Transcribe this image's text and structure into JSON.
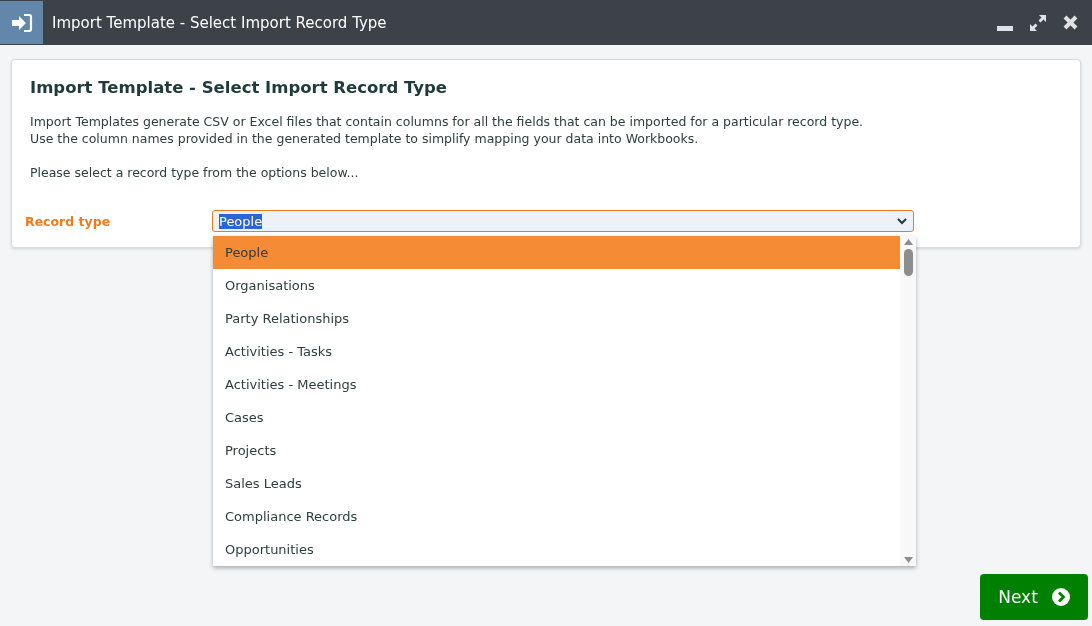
{
  "window": {
    "title": "Import Template - Select Import Record Type"
  },
  "card": {
    "heading": "Import Template - Select Import Record Type",
    "description": [
      "Import Templates generate CSV or Excel files that contain columns for all the fields that can be imported for a particular record type.",
      "Use the column names provided in the generated template to simplify mapping your data into Workbooks."
    ],
    "instruction": "Please select a record type from the options below...",
    "field_label": "Record type",
    "field_value": "People",
    "dropdown_open": true
  },
  "options": [
    {
      "label": "People",
      "selected": true
    },
    {
      "label": "Organisations",
      "selected": false
    },
    {
      "label": "Party Relationships",
      "selected": false
    },
    {
      "label": "Activities - Tasks",
      "selected": false
    },
    {
      "label": "Activities - Meetings",
      "selected": false
    },
    {
      "label": "Cases",
      "selected": false
    },
    {
      "label": "Projects",
      "selected": false
    },
    {
      "label": "Sales Leads",
      "selected": false
    },
    {
      "label": "Compliance Records",
      "selected": false
    },
    {
      "label": "Opportunities",
      "selected": false
    }
  ],
  "next_button": "Next"
}
